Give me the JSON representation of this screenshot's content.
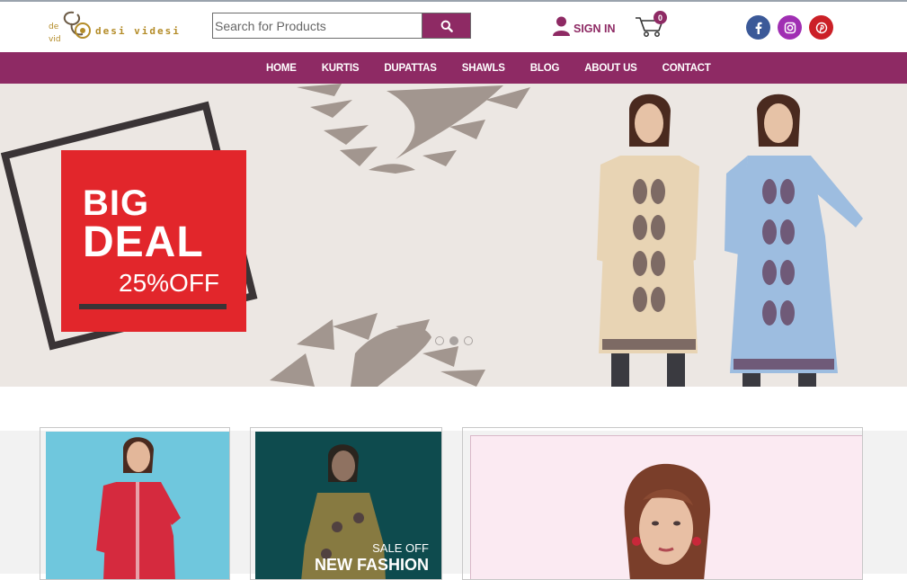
{
  "brand": {
    "logo_text": "desi videsi",
    "logo_mark_text": "desi videsi",
    "accent": "#8e2a64"
  },
  "search": {
    "placeholder": "Search for Products",
    "value": ""
  },
  "account": {
    "signin_label": "SIGN IN"
  },
  "cart": {
    "count": "0"
  },
  "social": [
    "facebook-icon",
    "instagram-icon",
    "pinterest-icon"
  ],
  "nav": {
    "items": [
      "HOME",
      "KURTIS",
      "DUPATTAS",
      "SHAWLS",
      "BLOG",
      "ABOUT US",
      "CONTACT"
    ]
  },
  "hero": {
    "headline_1": "BIG",
    "headline_2": "DEAL",
    "offer": "25%OFF",
    "slides": 3,
    "active_slide": 2
  },
  "promo": {
    "sale_label": "SALE OFF",
    "title": "NEW FASHION"
  }
}
